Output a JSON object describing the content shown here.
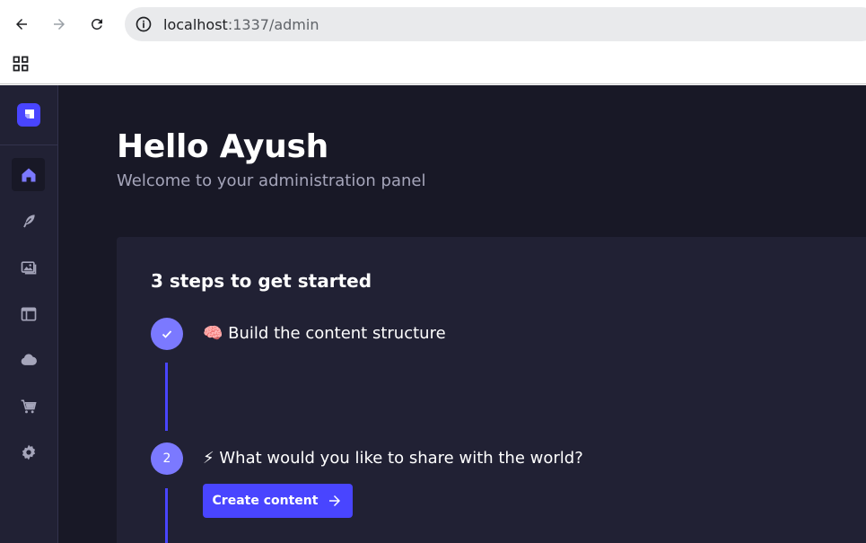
{
  "browser": {
    "url_host": "localhost",
    "url_path": ":1337/admin",
    "icons": [
      "back-arrow-icon",
      "forward-arrow-icon",
      "reload-icon",
      "site-info-icon",
      "apps-grid-icon"
    ]
  },
  "sidebar": {
    "items": [
      {
        "name": "home",
        "icon": "home-icon",
        "active": true
      },
      {
        "name": "content-manager",
        "icon": "feather-icon"
      },
      {
        "name": "media-library",
        "icon": "images-icon"
      },
      {
        "name": "content-type-builder",
        "icon": "layout-icon"
      },
      {
        "name": "cloud",
        "icon": "cloud-icon"
      },
      {
        "name": "marketplace",
        "icon": "cart-icon"
      },
      {
        "name": "settings",
        "icon": "gear-icon"
      }
    ]
  },
  "header": {
    "title": "Hello Ayush",
    "subtitle": "Welcome to your administration panel"
  },
  "guided_tour": {
    "title": "3 steps to get started",
    "steps": [
      {
        "status": "done",
        "emoji": "🧠",
        "label": "Build the content structure"
      },
      {
        "number": "2",
        "emoji": "⚡",
        "label": "What would you like to share with the world?"
      }
    ],
    "cta_label": "Create content"
  },
  "colors": {
    "accent": "#4945ff",
    "step_circle": "#7b79ff",
    "background": "#181826",
    "panel": "#212134"
  }
}
